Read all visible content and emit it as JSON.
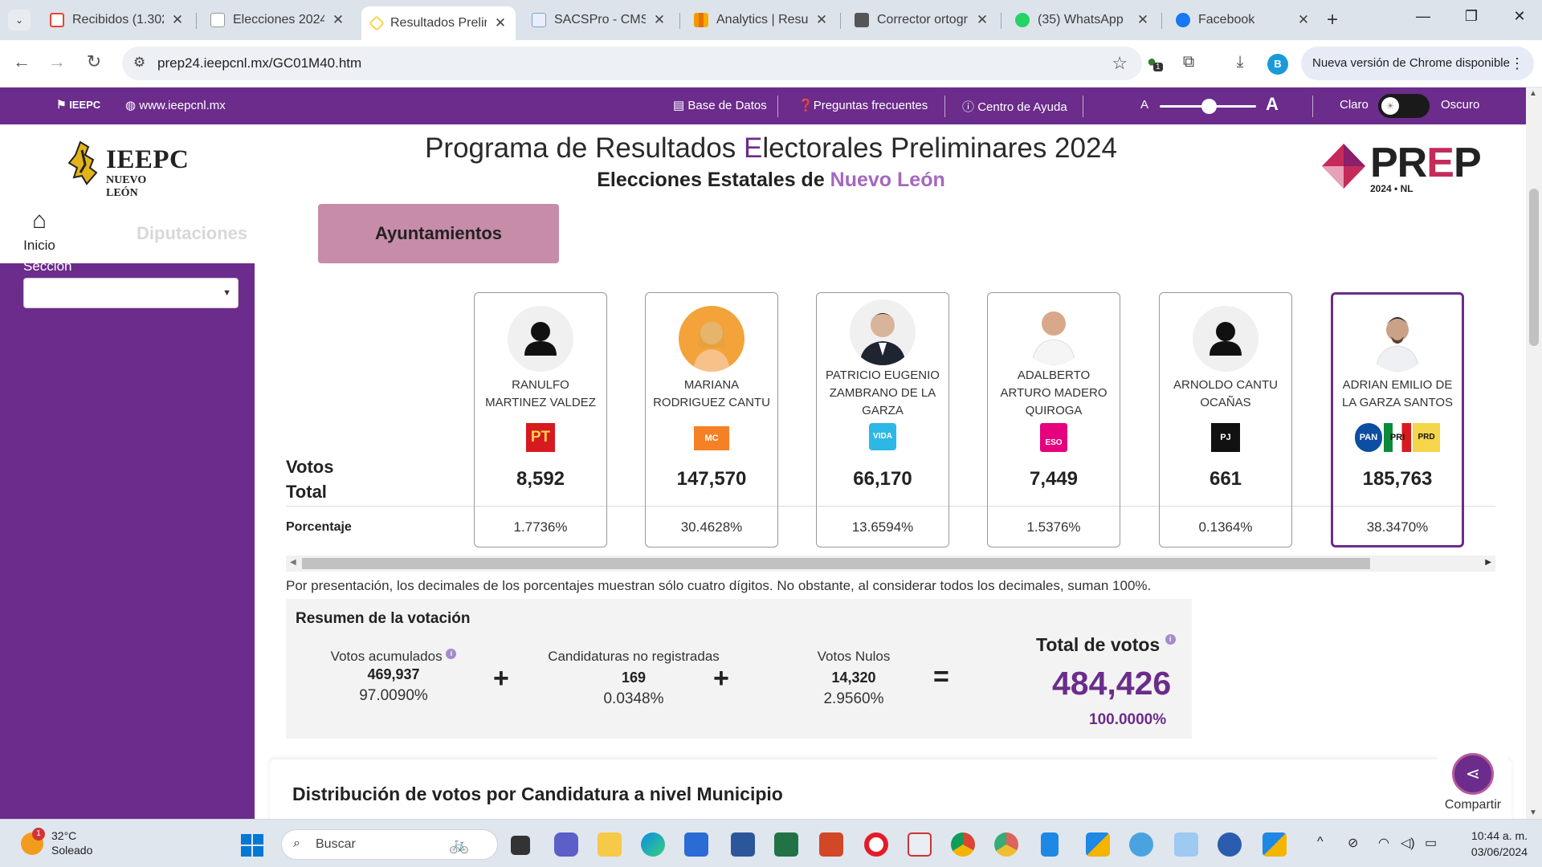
{
  "browser": {
    "tabs": [
      {
        "title": "Recibidos (1.302",
        "color": "#ea4335"
      },
      {
        "title": "Elecciones 2024:",
        "color": "#ffffff"
      },
      {
        "title": "Resultados Prelir",
        "color": "#f5d54a"
      },
      {
        "title": "SACSPro - CMS",
        "color": "#7aa2d6"
      },
      {
        "title": "Analytics | Resun",
        "color": "#f29900"
      },
      {
        "title": "Corrector ortogr",
        "color": "#555555"
      },
      {
        "title": "(35) WhatsApp",
        "color": "#25d366"
      },
      {
        "title": "Facebook",
        "color": "#1877f2"
      }
    ],
    "url": "prep24.ieepcnl.mx/GC01M40.htm",
    "extension_badge": "1",
    "profile_initial": "B",
    "update_label": "Nueva versión de Chrome disponible"
  },
  "site_top": {
    "site_link": "www.ieepcnl.mx",
    "base_datos": "Base de Datos",
    "preguntas": "Preguntas frecuentes",
    "ayuda": "Centro de Ayuda",
    "font_small": "A",
    "font_large": "A",
    "claro": "Claro",
    "oscuro": "Oscuro",
    "logo_small": "IEEPC"
  },
  "header": {
    "ieepc_name": "IEEPC",
    "ieepc_sub": "NUEVO LEÓN",
    "title_pre": "Programa de Resultados ",
    "title_e": "E",
    "title_post": "lectorales Preliminares 2024",
    "subtitle_pre": "Elecciones Estatales de ",
    "subtitle_state": "Nuevo León",
    "prep_pre": "PR",
    "prep_e": "E",
    "prep_post": "P",
    "prep_sub": "2024  •  NL"
  },
  "nav": {
    "home": "Inicio",
    "diputaciones": "Diputaciones",
    "ayuntamientos": "Ayuntamientos"
  },
  "sidebar": {
    "seccion_label": "Sección",
    "seccion_value": ""
  },
  "results": {
    "votos_label_1": "Votos",
    "votos_label_2": "Total",
    "pct_label": "Porcentaje",
    "candidates": [
      {
        "name": "RANULFO MARTINEZ VALDEZ",
        "party": "PT",
        "votes": "8,592",
        "pct": "1.7736%",
        "party_color": "#d71920"
      },
      {
        "name": "MARIANA RODRIGUEZ CANTU",
        "party": "MC",
        "votes": "147,570",
        "pct": "30.4628%",
        "party_color": "#f58025"
      },
      {
        "name": "PATRICIO EUGENIO ZAMBRANO DE LA GARZA",
        "party": "VIDA",
        "votes": "66,170",
        "pct": "13.6594%",
        "party_color": "#2db7e5"
      },
      {
        "name": "ADALBERTO ARTURO MADERO QUIROGA",
        "party": "ESO",
        "votes": "7,449",
        "pct": "1.5376%",
        "party_color": "#e6007e"
      },
      {
        "name": "ARNOLDO CANTU OCAÑAS",
        "party": "PJ",
        "votes": "661",
        "pct": "0.1364%",
        "party_color": "#111111"
      },
      {
        "name": "ADRIAN EMILIO DE LA GARZA SANTOS",
        "party": "PAN PRI PRD",
        "votes": "185,763",
        "pct": "38.3470%",
        "party_color": "#0b4ea2"
      }
    ],
    "note": "Por presentación, los decimales de los porcentajes muestran sólo cuatro dígitos. No obstante, al considerar todos los decimales, suman 100%."
  },
  "summary": {
    "title": "Resumen de la votación",
    "acumulados_label": "Votos acumulados",
    "acumulados_num": "469,937",
    "acumulados_pct": "97.0090%",
    "no_reg_label": "Candidaturas no registradas",
    "no_reg_num": "169",
    "no_reg_pct": "0.0348%",
    "nulos_label": "Votos Nulos",
    "nulos_num": "14,320",
    "nulos_pct": "2.9560%",
    "total_label": "Total de votos",
    "total_num": "484,426",
    "total_pct": "100.0000%",
    "plus": "+",
    "equals": "="
  },
  "distribution_title": "Distribución de votos por Candidatura a nivel Municipio",
  "share_label": "Compartir",
  "taskbar": {
    "weather_badge": "1",
    "temp": "32°C",
    "condition": "Soleado",
    "search_placeholder": "Buscar",
    "time": "10:44 a. m.",
    "date": "03/06/2024"
  }
}
